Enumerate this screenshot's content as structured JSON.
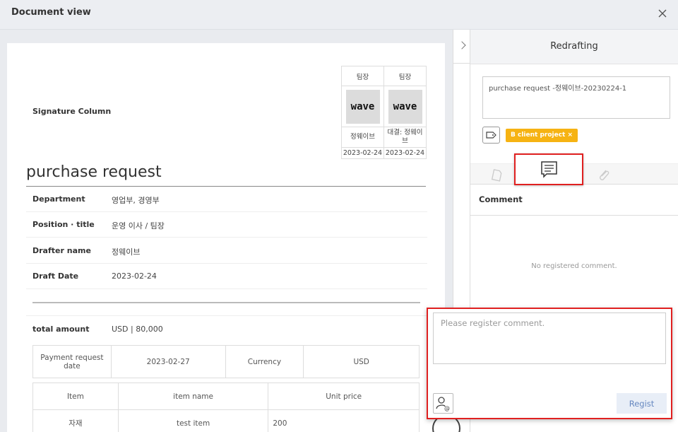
{
  "window": {
    "title": "Document view"
  },
  "document": {
    "signature_label": "Signature Column",
    "signatures": [
      {
        "role": "팀장",
        "stamp": "wave",
        "name": "정웨이브",
        "date": "2023-02-24"
      },
      {
        "role": "팀장",
        "stamp": "wave",
        "name": "대결: 정웨이브",
        "date": "2023-02-24"
      }
    ],
    "title": "purchase request",
    "fields": [
      {
        "label": "Department",
        "value": "영업부, 경영부"
      },
      {
        "label": "Position · title",
        "value": "운영 이사 / 팀장"
      },
      {
        "label": "Drafter name",
        "value": "정웨이브"
      },
      {
        "label": "Draft Date",
        "value": "2023-02-24"
      }
    ],
    "total": {
      "label": "total amount",
      "value": "USD | 80,000"
    },
    "payment_row": {
      "date_label": "Payment request date",
      "date_value": "2023-02-27",
      "currency_label": "Currency",
      "currency_value": "USD"
    },
    "items_table": {
      "headers": [
        "Item",
        "item name",
        "Unit price"
      ],
      "rows": [
        [
          "자재",
          "test item",
          "200"
        ]
      ]
    }
  },
  "side_panel": {
    "header": "Redrafting",
    "document_name": "purchase request -정웨이브-20230224-1",
    "tag": "B client project ×",
    "comment_title": "Comment",
    "empty_text": "No registered comment.",
    "comment_placeholder": "Please register comment.",
    "submit_label": "Regist"
  }
}
